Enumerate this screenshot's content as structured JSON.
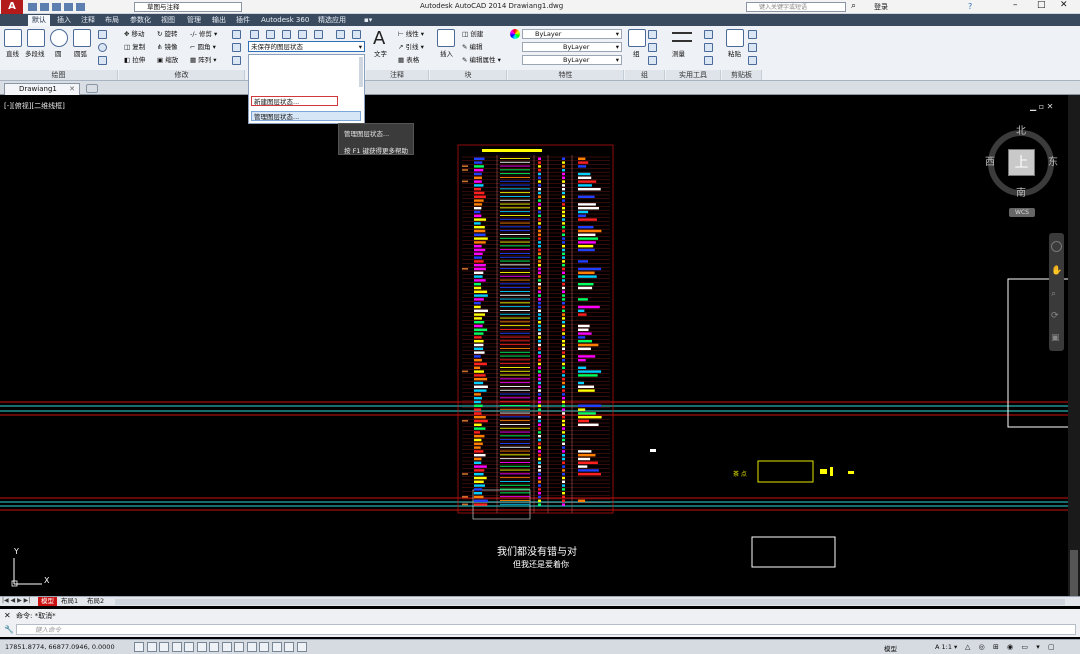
{
  "app": {
    "title": "Autodesk AutoCAD 2014   Drawiang1.dwg",
    "workspace": "草图与注释",
    "search_placeholder": "键入关键字或短语",
    "signin": "登录",
    "help": "?"
  },
  "tabs": [
    "默认",
    "插入",
    "注释",
    "布局",
    "参数化",
    "视图",
    "管理",
    "输出",
    "插件",
    "Autodesk 360",
    "精选应用"
  ],
  "ribbon": {
    "draw": {
      "label": "绘图",
      "tools": [
        "直线",
        "多段线",
        "圆",
        "圆弧"
      ]
    },
    "modify": {
      "label": "修改",
      "tools": [
        "移动",
        "旋转",
        "修剪",
        "复制",
        "镜像",
        "圆角",
        "拉伸",
        "缩放",
        "阵列"
      ]
    },
    "layer": {
      "state": "未保存的图层状态"
    },
    "annotation": {
      "label": "注释",
      "tools": [
        "文字",
        "线性",
        "引线",
        "表格"
      ]
    },
    "block": {
      "label": "块",
      "tools": [
        "插入",
        "创建",
        "编辑",
        "编辑属性"
      ]
    },
    "properties": {
      "label": "特性",
      "bylayer": [
        "ByLayer",
        "ByLayer",
        "ByLayer"
      ]
    },
    "group": {
      "label": "组",
      "tools": [
        "组"
      ]
    },
    "utilities": {
      "label": "实用工具",
      "tools": [
        "测量"
      ]
    },
    "clipboard": {
      "label": "剪贴板",
      "tools": [
        "粘贴"
      ]
    }
  },
  "layer_menu": {
    "new": "新建图层状态...",
    "manage": "管理图层状态..."
  },
  "tooltip": {
    "title": "管理图层状态...",
    "hint": "按 F1 键获得更多帮助"
  },
  "document_tab": "Drawiang1",
  "viewport_label": "[-][俯视][二维线框]",
  "viewcube": {
    "north": "北",
    "south": "南",
    "east": "东",
    "west": "西",
    "top": "上",
    "wcs": "WCS"
  },
  "canvas_text": {
    "line1": "我们都没有错与对",
    "line2": "但我还是爱着你",
    "small": "茶 点"
  },
  "layouts": [
    "模型",
    "布局1",
    "布局2"
  ],
  "command": {
    "history": "命令: *取消*",
    "placeholder": "键入命令"
  },
  "statusbar": {
    "coords": "17851.8774, 66877.0946, 0.0000",
    "model": "模型",
    "scale": "1:1"
  },
  "colors": {
    "accent": "#2f6fb5",
    "cad_red": "#cc1111",
    "cad_cyan": "#30d8d8",
    "menu_highlight": "#d0393c"
  }
}
